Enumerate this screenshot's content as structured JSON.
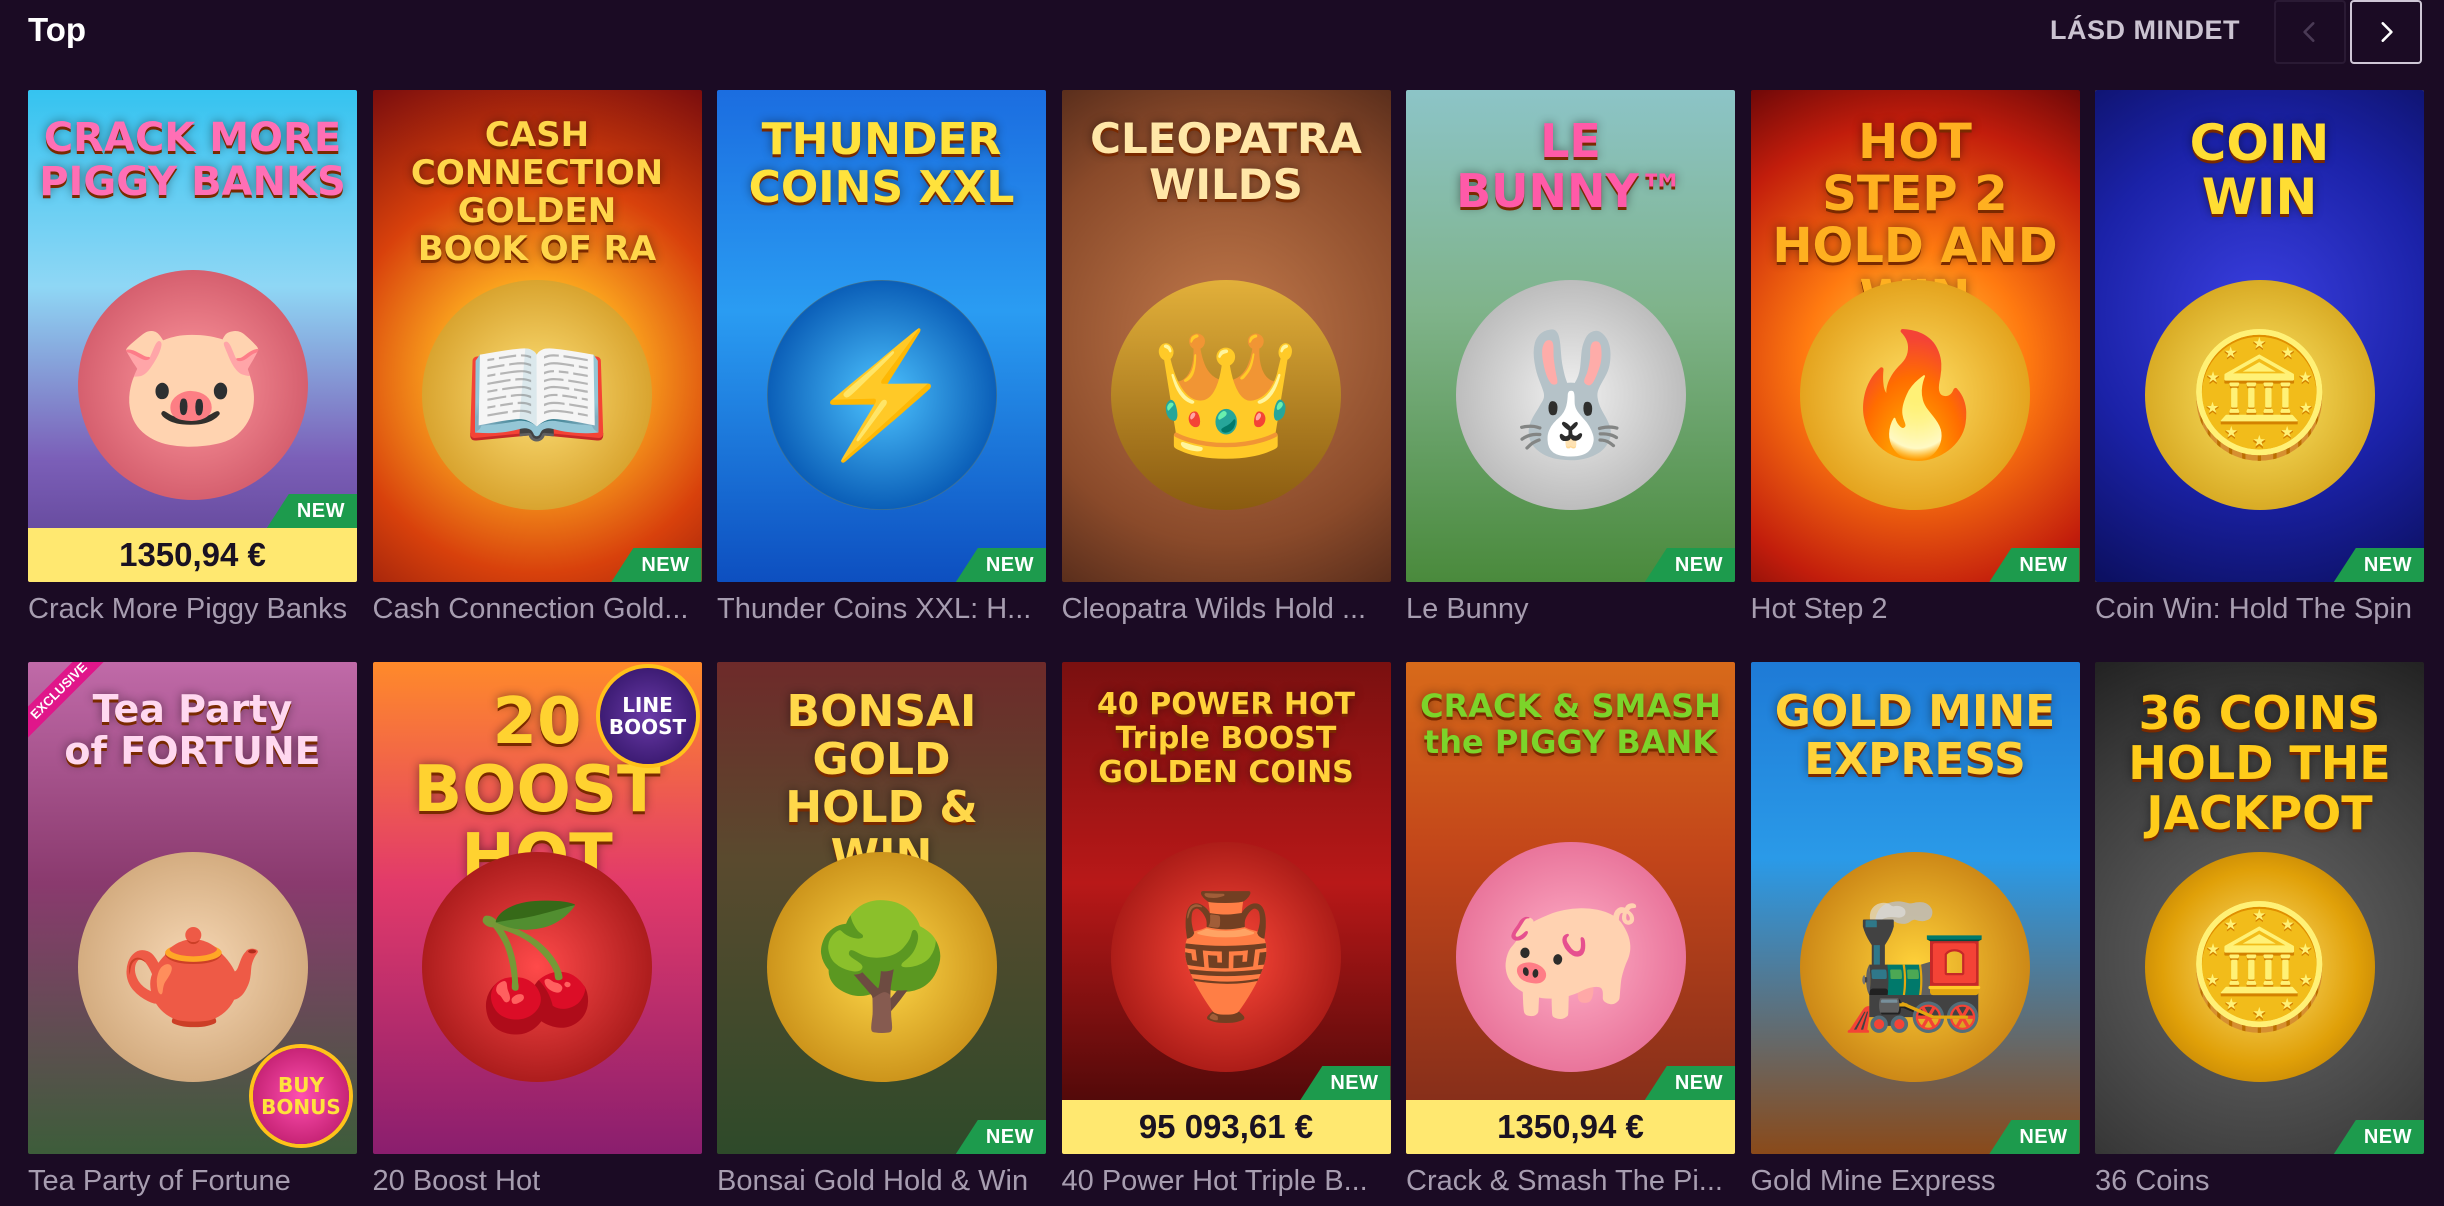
{
  "section": {
    "title": "Top",
    "see_all": "LÁSD MINDET"
  },
  "badges": {
    "new": "NEW",
    "exclusive": "EXCLUSIVE"
  },
  "games": [
    {
      "name": "Crack More Piggy Banks",
      "logo": "CRACK MORE\nPIGGY BANKS",
      "new": true,
      "jackpot": "1350,94 €",
      "emblem": "🐷"
    },
    {
      "name": "Cash Connection Gold...",
      "logo": "CASH CONNECTION\nGOLDEN\nBOOK OF RA",
      "new": true,
      "emblem": "📖"
    },
    {
      "name": "Thunder Coins XXL: H...",
      "logo": "THUNDER\nCOINS XXL",
      "new": true,
      "emblem": "⚡"
    },
    {
      "name": "Cleopatra Wilds Hold ...",
      "logo": "CLEOPATRA\nWILDS",
      "new": false,
      "emblem": "👑"
    },
    {
      "name": "Le Bunny",
      "logo": "LE\nBUNNY™",
      "new": true,
      "emblem": "🐰"
    },
    {
      "name": "Hot Step 2",
      "logo": "HOT\nSTEP 2\nHOLD AND WIN",
      "new": true,
      "emblem": "🔥"
    },
    {
      "name": "Coin Win: Hold The Spin",
      "logo": "COIN\nWIN",
      "new": true,
      "selected": true,
      "emblem": "🪙"
    },
    {
      "name": "Tea Party of Fortune",
      "logo": "Tea Party\nof FORTUNE",
      "new": false,
      "exclusive": true,
      "round_badge": "BUY\nBONUS",
      "emblem": "🫖"
    },
    {
      "name": "20 Boost Hot",
      "logo": "20\nBOOST\nHOT",
      "new": false,
      "round_badge": "LINE\nBOOST",
      "emblem": "🍒"
    },
    {
      "name": "Bonsai Gold Hold & Win",
      "logo": "BONSAI\nGOLD\nHOLD & WIN",
      "new": true,
      "emblem": "🌳"
    },
    {
      "name": "40 Power Hot Triple B...",
      "logo": "40 POWER HOT\nTriple BOOST\nGOLDEN COINS",
      "new": true,
      "jackpot": "95 093,61 €",
      "emblem": "🏺"
    },
    {
      "name": "Crack & Smash The Pi...",
      "logo": "CRACK & SMASH\nthe PIGGY BANK",
      "new": true,
      "jackpot": "1350,94 €",
      "emblem": "🐖"
    },
    {
      "name": "Gold Mine Express",
      "logo": "GOLD MINE\nEXPRESS",
      "new": true,
      "emblem": "🚂"
    },
    {
      "name": "36 Coins",
      "logo": "36 COINS\nHOLD THE JACKPOT",
      "new": true,
      "emblem": "🪙"
    }
  ],
  "colors": {
    "background": "#1b0b24",
    "new_badge": "#1d9b4d",
    "jackpot_bar": "#ffe870",
    "selected_border": "#ffd21f",
    "caption": "#a79db0"
  },
  "icons": {
    "prev": "chevron-left-icon",
    "next": "chevron-right-icon"
  }
}
